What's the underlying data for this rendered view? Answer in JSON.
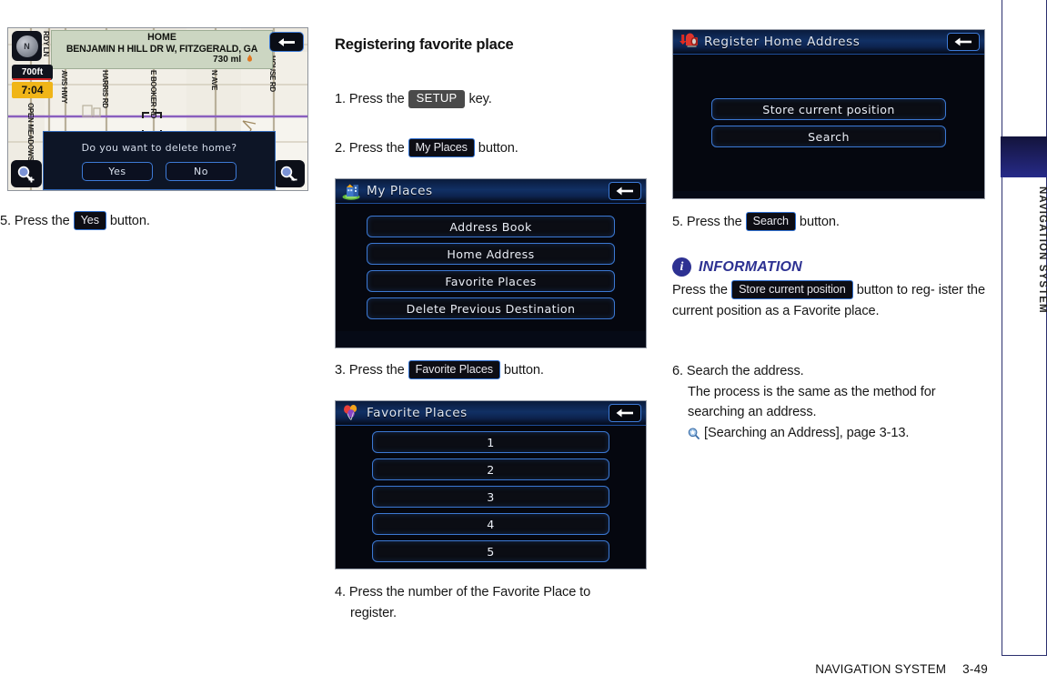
{
  "left_column": {
    "map_screen": {
      "compass_label": "N",
      "scale": "700ft",
      "clock": "7:04",
      "banner": {
        "line1": "HOME",
        "line2": "BENJAMIN H HILL DR W, FITZGERALD, GA",
        "line3": "730 ml"
      },
      "street_labels": [
        "RDY LN",
        "AVIS HWY",
        "HARRIS RD",
        "E BOOKER RD",
        "N AVE",
        "HOUSE RD",
        "OPEN MEADOWS"
      ],
      "dialog": {
        "question": "Do you want to delete home?",
        "yes_label": "Yes",
        "no_label": "No"
      },
      "zoom_in_icon": "magnifier-plus-icon",
      "zoom_out_icon": "magnifier-minus-icon",
      "back_icon": "back-arrow-icon"
    },
    "step5": {
      "before": "5. Press the",
      "chip": "Yes",
      "after": "button."
    }
  },
  "mid_column": {
    "heading": "Registering favorite place",
    "step1": {
      "before": "1. Press the",
      "chip": "SETUP",
      "after": "key."
    },
    "step2": {
      "before": "2. Press the",
      "chip": "My Places",
      "after": "button."
    },
    "my_places_screen": {
      "title": "My Places",
      "icon": "my-places-building-icon",
      "back_icon": "back-arrow-icon",
      "buttons": [
        "Address Book",
        "Home Address",
        "Favorite Places",
        "Delete Previous Destination"
      ]
    },
    "step3": {
      "before": "3. Press the",
      "chip": "Favorite Places",
      "after": "button."
    },
    "favorite_places_screen": {
      "title": "Favorite Places",
      "icon": "balloons-icon",
      "back_icon": "back-arrow-icon",
      "buttons": [
        "1",
        "2",
        "3",
        "4",
        "5"
      ]
    },
    "step4": {
      "line1": "4. Press the number of the Favorite Place to",
      "line2": "register."
    }
  },
  "right_column": {
    "register_home_screen": {
      "title": "Register Home Address",
      "icon": "mailbox-icon",
      "back_icon": "back-arrow-icon",
      "buttons": [
        "Store current position",
        "Search"
      ]
    },
    "step5": {
      "before": "5. Press the",
      "chip": "Search",
      "after": "button."
    },
    "information": {
      "badge": "i",
      "title": "INFORMATION",
      "before": "Press the",
      "chip": "Store current position",
      "after_line1": "button to reg-",
      "after_line2": "ister the current position as a Favorite place."
    },
    "step6": {
      "line1": "6. Search the address.",
      "line2": "The process is the same as the method for",
      "line3": "searching an address.",
      "ref_icon": "reference-magnifier-icon",
      "ref": "[Searching an Address], page 3-13."
    }
  },
  "sidebar": {
    "label": "NAVIGATION SYSTEM"
  },
  "footer": {
    "title": "NAVIGATION SYSTEM",
    "page": "3-49"
  },
  "colors": {
    "accent_blue": "#2d3192",
    "chip_border": "#2f6fd0",
    "chip_bg": "#0d0d14",
    "key_bg": "#4a4a4a",
    "navi_title": "#113064"
  }
}
